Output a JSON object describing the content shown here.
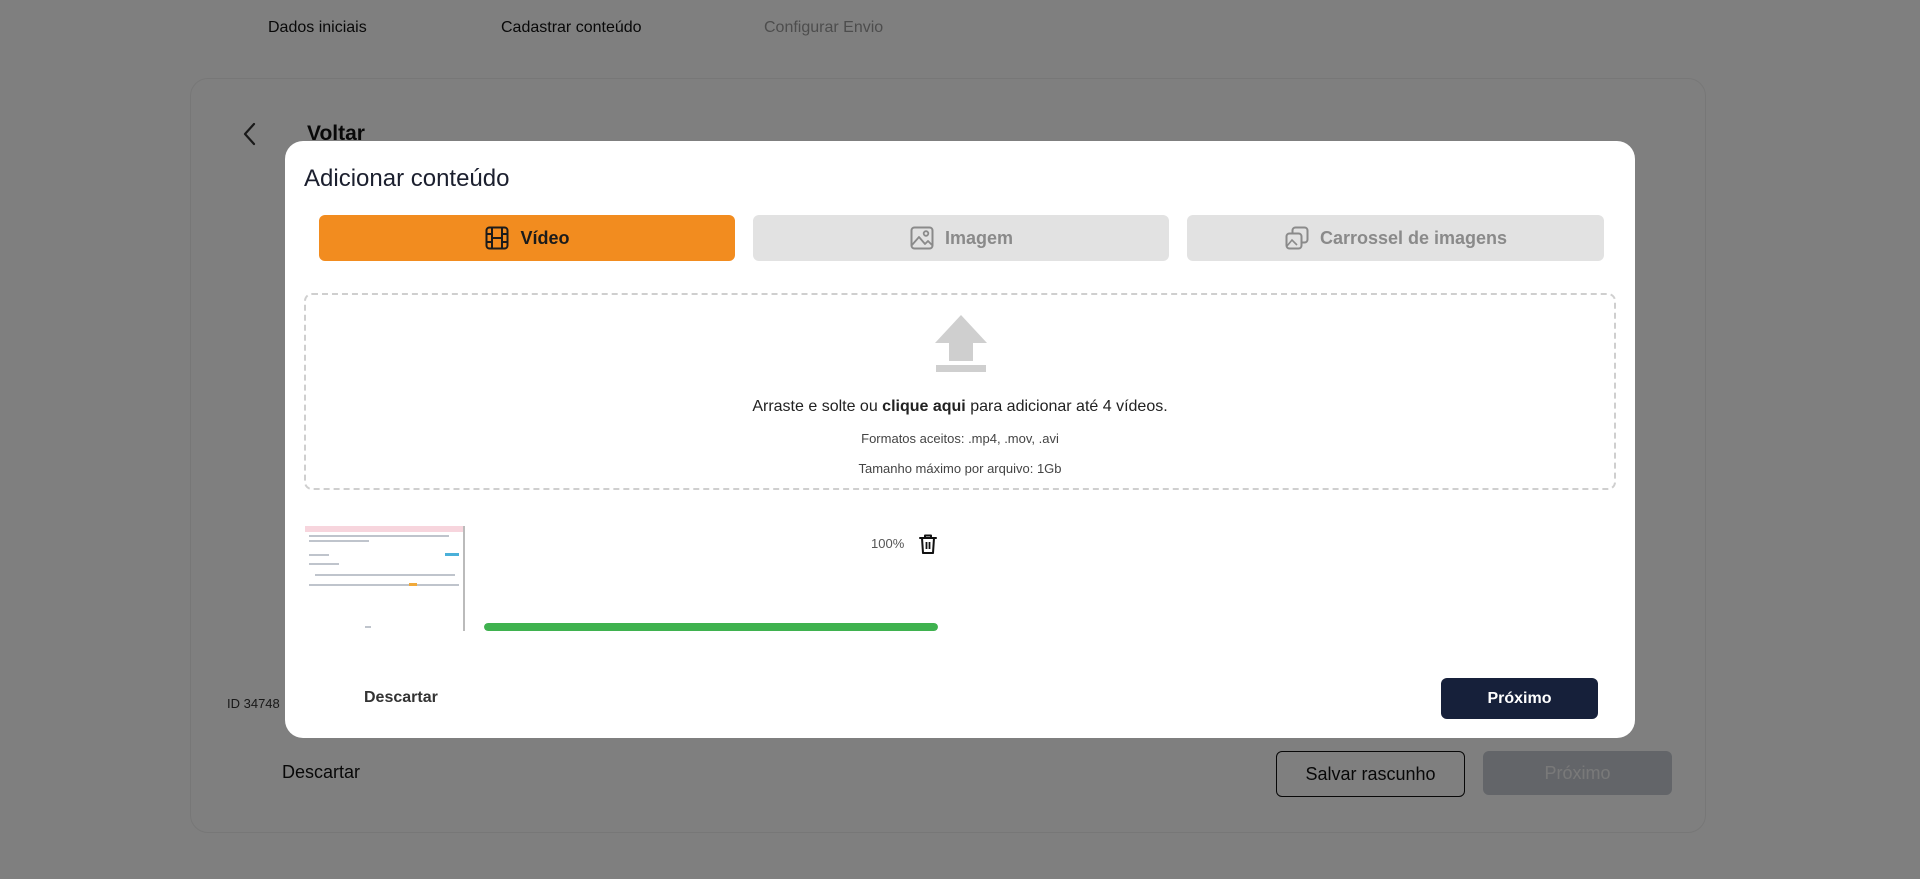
{
  "steps": [
    {
      "label": "Dados iniciais"
    },
    {
      "label": "Cadastrar conteúdo"
    },
    {
      "label": "Configurar Envio"
    }
  ],
  "background": {
    "back_label": "Voltar",
    "id_text": "ID 34748",
    "discard_label": "Descartar",
    "save_draft_label": "Salvar rascunho",
    "next_label": "Próximo"
  },
  "modal": {
    "title": "Adicionar conteúdo",
    "tabs": [
      {
        "label": "Vídeo",
        "icon": "film-icon",
        "active": true
      },
      {
        "label": "Imagem",
        "icon": "image-icon",
        "active": false
      },
      {
        "label": "Carrossel de imagens",
        "icon": "images-icon",
        "active": false
      }
    ],
    "dropzone": {
      "icon": "upload-icon",
      "text_before": "Arraste e solte ou ",
      "text_bold": "clique aqui",
      "text_after": " para adicionar até 4 vídeos.",
      "formats": "Formatos aceitos: .mp4, .mov, .avi",
      "max_size": "Tamanho máximo por arquivo: 1Gb"
    },
    "upload": {
      "percent_label": "100%",
      "progress": 1.0,
      "icon": "trash-icon"
    },
    "discard_label": "Descartar",
    "next_label": "Próximo"
  },
  "colors": {
    "accent": "#f28c1f",
    "primary_dark": "#16203a",
    "progress_green": "#3fb24f",
    "overlay": "rgba(0,0,0,0.5)"
  }
}
